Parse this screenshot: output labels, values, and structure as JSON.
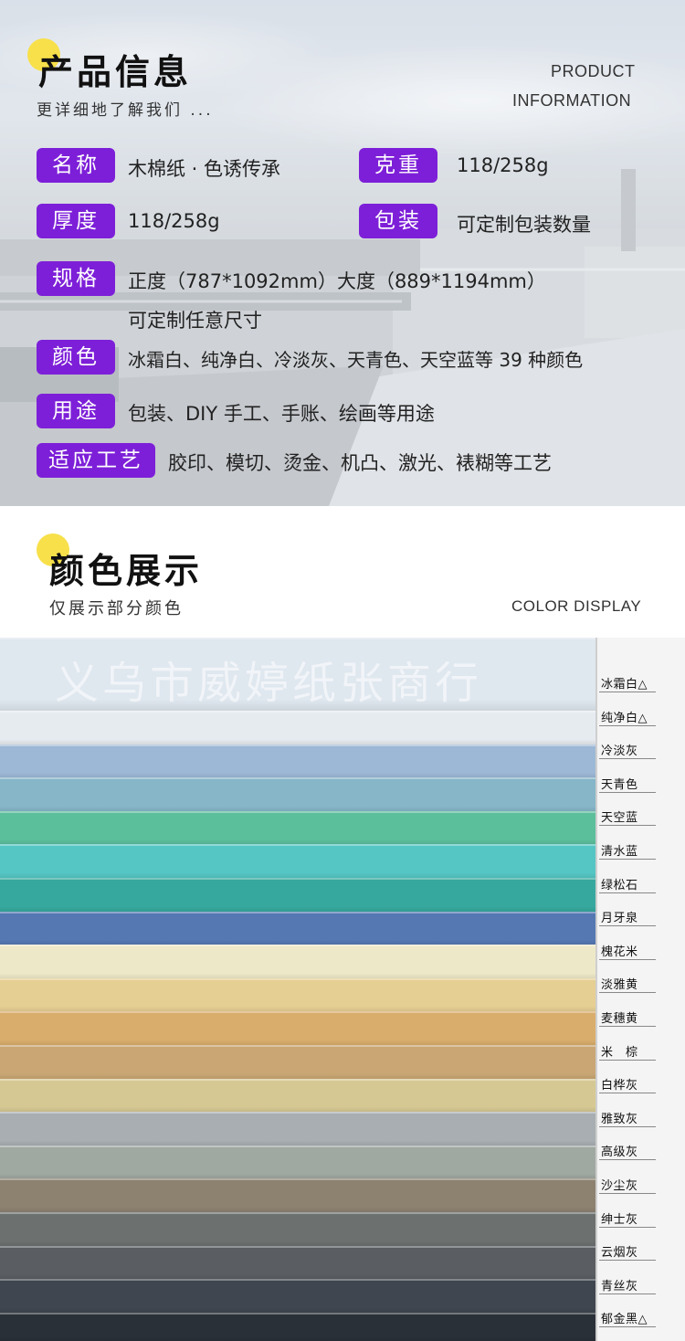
{
  "info_section": {
    "title": "产品信息",
    "subtitle": "更详细地了解我们 ...",
    "english_line1": "PRODUCT",
    "english_line2": "INFORMATION",
    "tag_color": "#7d1fd8",
    "accent_dot_color": "#f7e04a",
    "rows": {
      "name": {
        "label": "名称",
        "value": "木棉纸 · 色诱传承"
      },
      "weight": {
        "label": "克重",
        "value": "118/258g"
      },
      "thickness": {
        "label": "厚度",
        "value": "118/258g"
      },
      "packing": {
        "label": "包装",
        "value": "可定制包装数量"
      },
      "spec": {
        "label": "规格",
        "value_line1": "正度（787*1092mm）大度（889*1194mm）",
        "value_line2": "可定制任意尺寸"
      },
      "color": {
        "label": "颜色",
        "value": "冰霜白、纯净白、冷淡灰、天青色、天空蓝等 39 种颜色"
      },
      "usage": {
        "label": "用途",
        "value": "包装、DIY 手工、手账、绘画等用途"
      },
      "craft": {
        "label": "适应工艺",
        "value": "胶印、模切、烫金、机凸、激光、裱糊等工艺"
      }
    }
  },
  "display_section": {
    "title": "颜色展示",
    "subtitle": "仅展示部分颜色",
    "english": "COLOR DISPLAY",
    "watermark": "义乌市威婷纸张商行"
  },
  "swatches": [
    {
      "name": "冰霜白△",
      "color": "#dfe7ef"
    },
    {
      "name": "纯净白△",
      "color": "#e6ebf0"
    },
    {
      "name": "冷淡灰",
      "color": "#9db8d6"
    },
    {
      "name": "天青色",
      "color": "#86b6c8"
    },
    {
      "name": "天空蓝",
      "color": "#5cbf9c"
    },
    {
      "name": "清水蓝",
      "color": "#55c6c4"
    },
    {
      "name": "绿松石",
      "color": "#37a89e"
    },
    {
      "name": "月牙泉",
      "color": "#5578b3"
    },
    {
      "name": "槐花米",
      "color": "#ede8c8"
    },
    {
      "name": "淡雅黄",
      "color": "#e6cf92"
    },
    {
      "name": "麦穗黄",
      "color": "#d9ad6c"
    },
    {
      "name": "米　棕",
      "color": "#c9a673"
    },
    {
      "name": "白桦灰",
      "color": "#d6c893"
    },
    {
      "name": "雅致灰",
      "color": "#a8aeb2"
    },
    {
      "name": "高级灰",
      "color": "#a0a8a2"
    },
    {
      "name": "沙尘灰",
      "color": "#8d8270"
    },
    {
      "name": "绅士灰",
      "color": "#6c706f"
    },
    {
      "name": "云烟灰",
      "color": "#5a5e62"
    },
    {
      "name": "青丝灰",
      "color": "#3f4650"
    },
    {
      "name": "郁金黑△",
      "color": "#2a3038"
    }
  ]
}
